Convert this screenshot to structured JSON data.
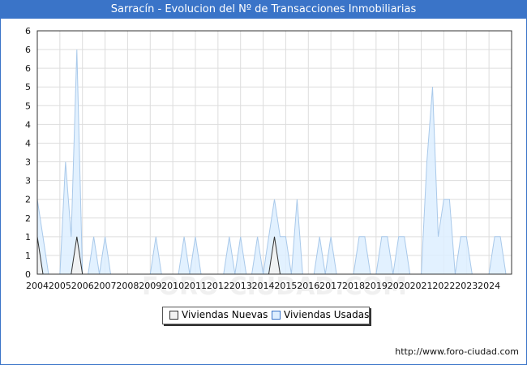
{
  "title": "Sarracín - Evolucion del Nº de Transacciones Inmobiliarias",
  "footer_url": "http://www.foro-ciudad.com",
  "watermark": "FORO-CIUDAD.COM",
  "colors": {
    "title_bg": "#3a74c8",
    "nuevas_fill": "#f2f2f2",
    "nuevas_line": "#333333",
    "usadas_fill": "#ddeeff",
    "usadas_line": "#a9c9ea",
    "grid": "#dddddd"
  },
  "chart_data": {
    "type": "area",
    "title": "Sarracín - Evolucion del Nº de Transacciones Inmobiliarias",
    "x_tick_labels": [
      "2004",
      "2005",
      "2006",
      "2007",
      "2008",
      "2009",
      "2010",
      "2011",
      "2012",
      "2013",
      "2014",
      "2015",
      "2016",
      "2017",
      "2018",
      "2019",
      "2020",
      "2021",
      "2022",
      "2023",
      "2024"
    ],
    "y_tick_labels": [
      "0",
      "1",
      "1",
      "2",
      "2",
      "3",
      "3",
      "4",
      "4",
      "5",
      "5",
      "6",
      "6",
      "6"
    ],
    "ylim": [
      0,
      6.5
    ],
    "x_range": [
      2004.0,
      2025.0
    ],
    "grid": true,
    "legend_position": "bottom-center",
    "series": [
      {
        "name": "Viviendas Nuevas",
        "points": [
          [
            2004.0,
            1
          ],
          [
            2004.25,
            0
          ],
          [
            2005.5,
            0
          ],
          [
            2005.75,
            1
          ],
          [
            2006.0,
            0
          ],
          [
            2014.25,
            0
          ],
          [
            2014.5,
            1
          ],
          [
            2014.75,
            0
          ]
        ]
      },
      {
        "name": "Viviendas Usadas",
        "points": [
          [
            2004.0,
            2
          ],
          [
            2004.25,
            1
          ],
          [
            2004.5,
            0
          ],
          [
            2005.0,
            0
          ],
          [
            2005.25,
            3
          ],
          [
            2005.5,
            1
          ],
          [
            2005.75,
            6
          ],
          [
            2006.0,
            0
          ],
          [
            2006.25,
            0
          ],
          [
            2006.5,
            1
          ],
          [
            2006.75,
            0
          ],
          [
            2007.0,
            1
          ],
          [
            2007.25,
            0
          ],
          [
            2009.0,
            0
          ],
          [
            2009.25,
            1
          ],
          [
            2009.5,
            0
          ],
          [
            2010.25,
            0
          ],
          [
            2010.5,
            1
          ],
          [
            2010.75,
            0
          ],
          [
            2011.0,
            1
          ],
          [
            2011.25,
            0
          ],
          [
            2012.25,
            0
          ],
          [
            2012.5,
            1
          ],
          [
            2012.75,
            0
          ],
          [
            2013.0,
            1
          ],
          [
            2013.25,
            0
          ],
          [
            2013.5,
            0
          ],
          [
            2013.75,
            1
          ],
          [
            2014.0,
            0
          ],
          [
            2014.25,
            1
          ],
          [
            2014.5,
            2
          ],
          [
            2014.75,
            1
          ],
          [
            2015.0,
            1
          ],
          [
            2015.25,
            0
          ],
          [
            2015.5,
            2
          ],
          [
            2015.75,
            0
          ],
          [
            2016.25,
            0
          ],
          [
            2016.5,
            1
          ],
          [
            2016.75,
            0
          ],
          [
            2017.0,
            1
          ],
          [
            2017.25,
            0
          ],
          [
            2018.0,
            0
          ],
          [
            2018.25,
            1
          ],
          [
            2018.5,
            1
          ],
          [
            2018.75,
            0
          ],
          [
            2019.0,
            0
          ],
          [
            2019.25,
            1
          ],
          [
            2019.5,
            1
          ],
          [
            2019.75,
            0
          ],
          [
            2020.0,
            1
          ],
          [
            2020.25,
            1
          ],
          [
            2020.5,
            0
          ],
          [
            2021.0,
            0
          ],
          [
            2021.25,
            3
          ],
          [
            2021.5,
            5
          ],
          [
            2021.75,
            1
          ],
          [
            2022.0,
            2
          ],
          [
            2022.25,
            2
          ],
          [
            2022.5,
            0
          ],
          [
            2022.75,
            1
          ],
          [
            2023.0,
            1
          ],
          [
            2023.25,
            0
          ],
          [
            2024.0,
            0
          ],
          [
            2024.25,
            1
          ],
          [
            2024.5,
            1
          ],
          [
            2024.75,
            0
          ]
        ]
      }
    ]
  }
}
